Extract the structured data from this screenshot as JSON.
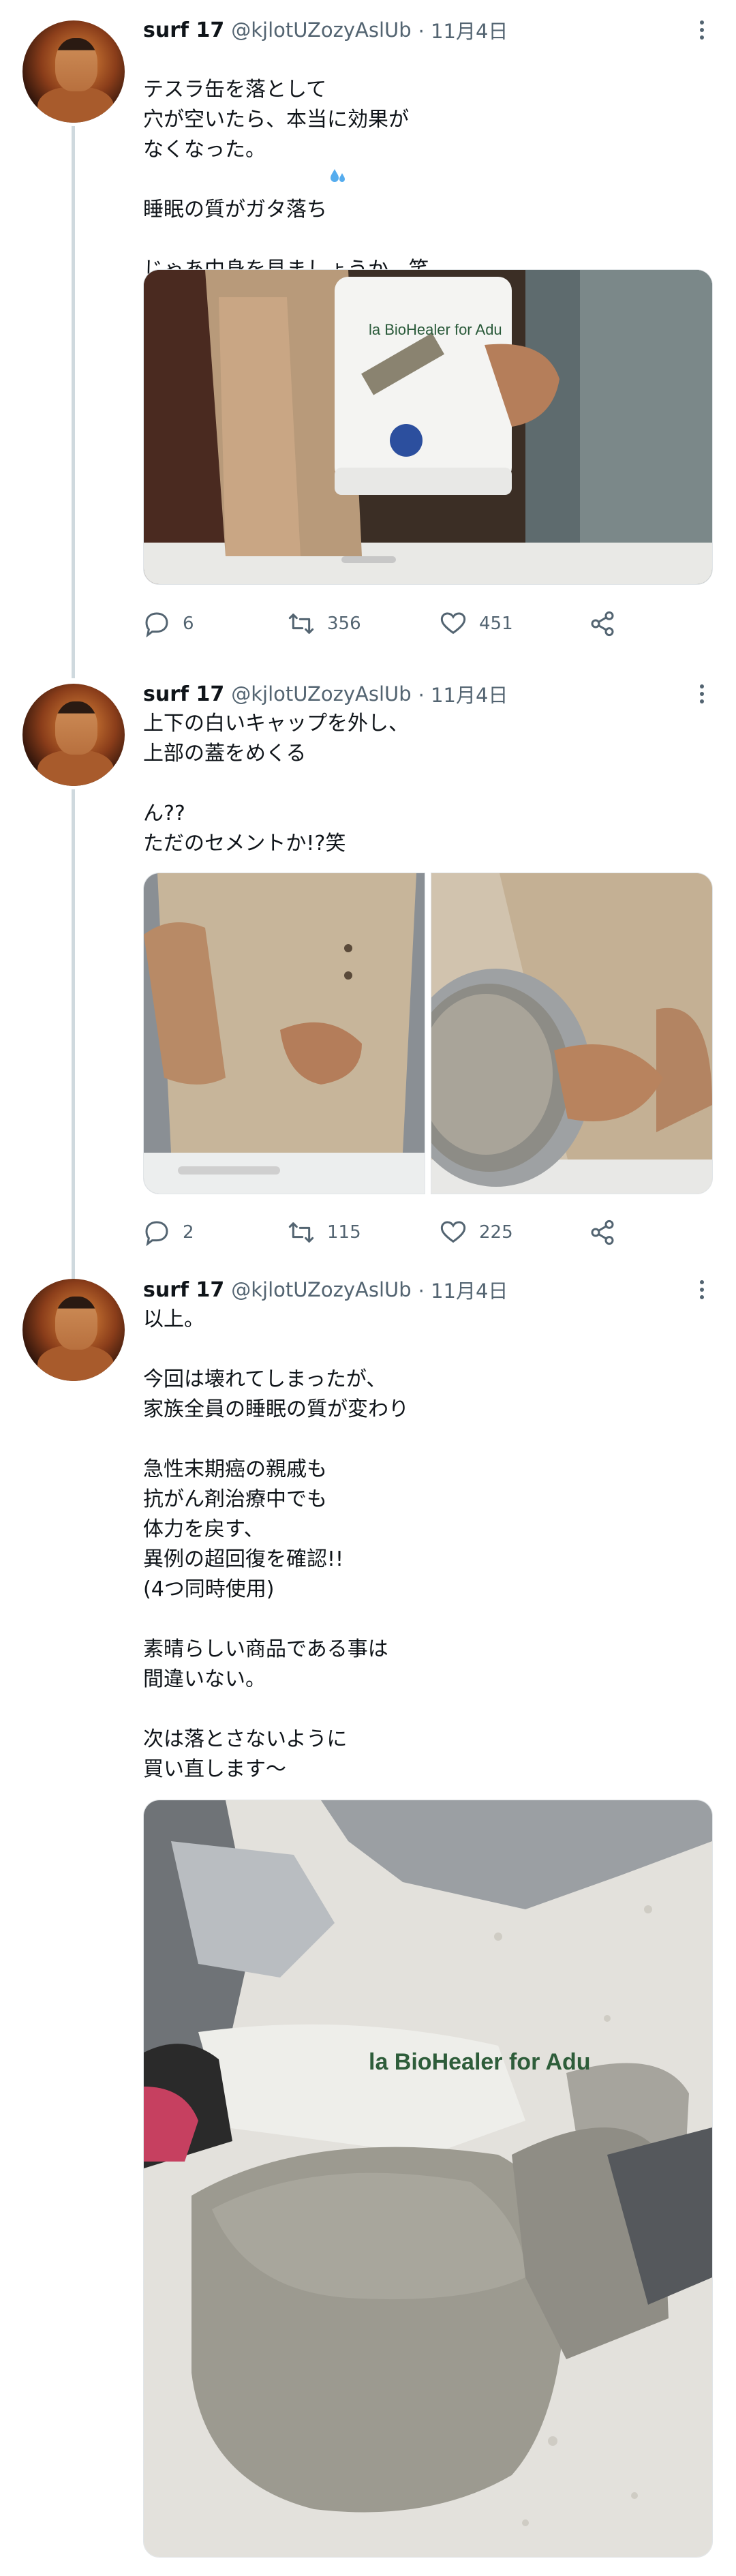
{
  "tweets": [
    {
      "name": "surf 17",
      "handle": "@kjlotUZozyAslUb",
      "date": "· 11月4日",
      "text": "テスラ缶を落として\n穴が空いたら、本当に効果が\nなくなった。\n\n睡眠の質がガタ落ち\n\nじゃあ中身を見ましょうか。笑",
      "emoji_icon": "sweat-droplets-icon",
      "replies": "6",
      "retweets": "356",
      "likes": "451",
      "media_label": "la BioHealer for Adu"
    },
    {
      "name": "surf 17",
      "handle": "@kjlotUZozyAslUb",
      "date": "· 11月4日",
      "text": "上下の白いキャップを外し、\n上部の蓋をめくる\n\nん??\nただのセメントか!?笑",
      "replies": "2",
      "retweets": "115",
      "likes": "225"
    },
    {
      "name": "surf 17",
      "handle": "@kjlotUZozyAslUb",
      "date": "· 11月4日",
      "text": "以上。\n\n今回は壊れてしまったが、\n家族全員の睡眠の質が変わり\n\n急性末期癌の親戚も\n抗がん剤治療中でも\n体力を戻す、\n異例の超回復を確認!!\n(4つ同時使用)\n\n素晴らしい商品である事は\n間違いない。\n\n次は落とさないように\n買い直します〜",
      "media_label": "la BioHealer for Adu"
    }
  ],
  "icons": {
    "reply": "reply-icon",
    "retweet": "retweet-icon",
    "like": "heart-icon",
    "share": "share-icon",
    "more": "more-icon"
  },
  "colors": {
    "text": "#0f1419",
    "secondary": "#536471",
    "thread_line": "#cfd9de",
    "emoji_blue": "#55acee"
  }
}
